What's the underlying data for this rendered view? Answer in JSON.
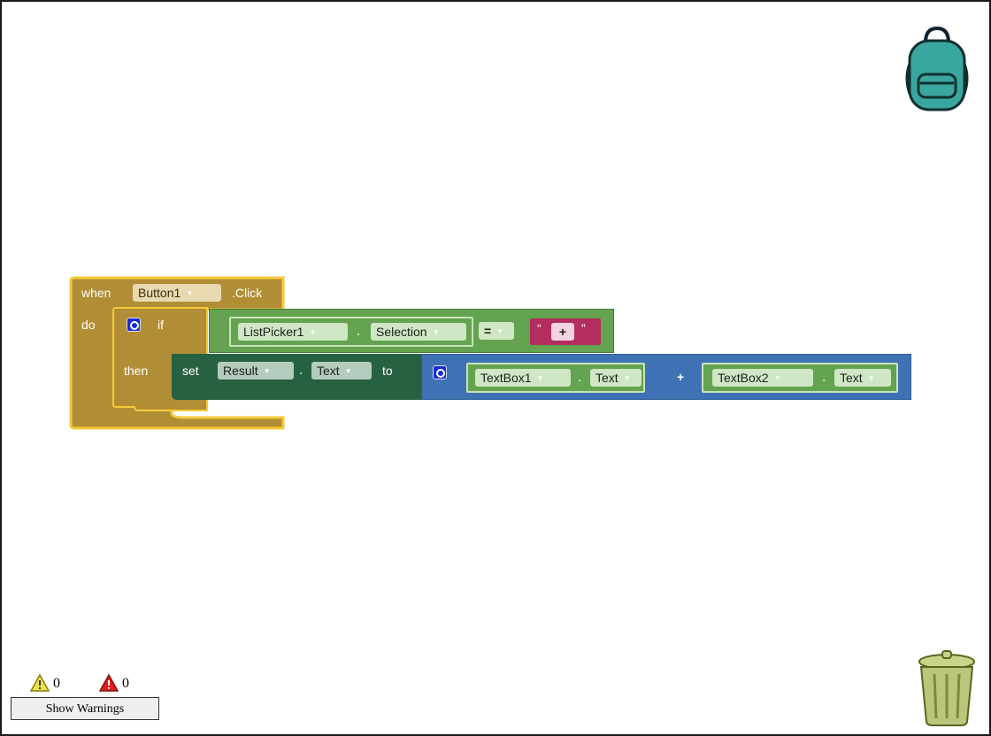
{
  "event_block": {
    "when_label": "when",
    "component": "Button1",
    "event": ".Click",
    "do_label": "do"
  },
  "if_block": {
    "if_label": "if",
    "then_label": "then"
  },
  "condition": {
    "component": "ListPicker1",
    "dot": ".",
    "property": "Selection",
    "operator": "=",
    "string_value": "+"
  },
  "set_block": {
    "set_label": "set",
    "component": "Result",
    "dot": ".",
    "property": "Text",
    "to_label": "to"
  },
  "addition": {
    "operator": "+",
    "left": {
      "component": "TextBox1",
      "dot": ".",
      "property": "Text"
    },
    "right": {
      "component": "TextBox2",
      "dot": ".",
      "property": "Text"
    }
  },
  "warnings": {
    "warning_count": "0",
    "error_count": "0",
    "show_button": "Show Warnings"
  },
  "icons": {
    "backpack": "backpack-icon",
    "trash": "trash-can-icon",
    "warning": "warning-triangle-icon",
    "error": "error-triangle-icon",
    "mutator": "gear-icon",
    "dropdown": "dropdown-arrow-icon"
  },
  "colors": {
    "event_block": "#b18e35",
    "control_block": "#b18e35",
    "selected_outline": "#f7c93a",
    "component_getter": "#64a34f",
    "component_setter": "#266141",
    "math_block": "#3f71b5",
    "text_block": "#b32d5e",
    "backpack": "#3aa6a0",
    "trash": "#b9c77a"
  }
}
